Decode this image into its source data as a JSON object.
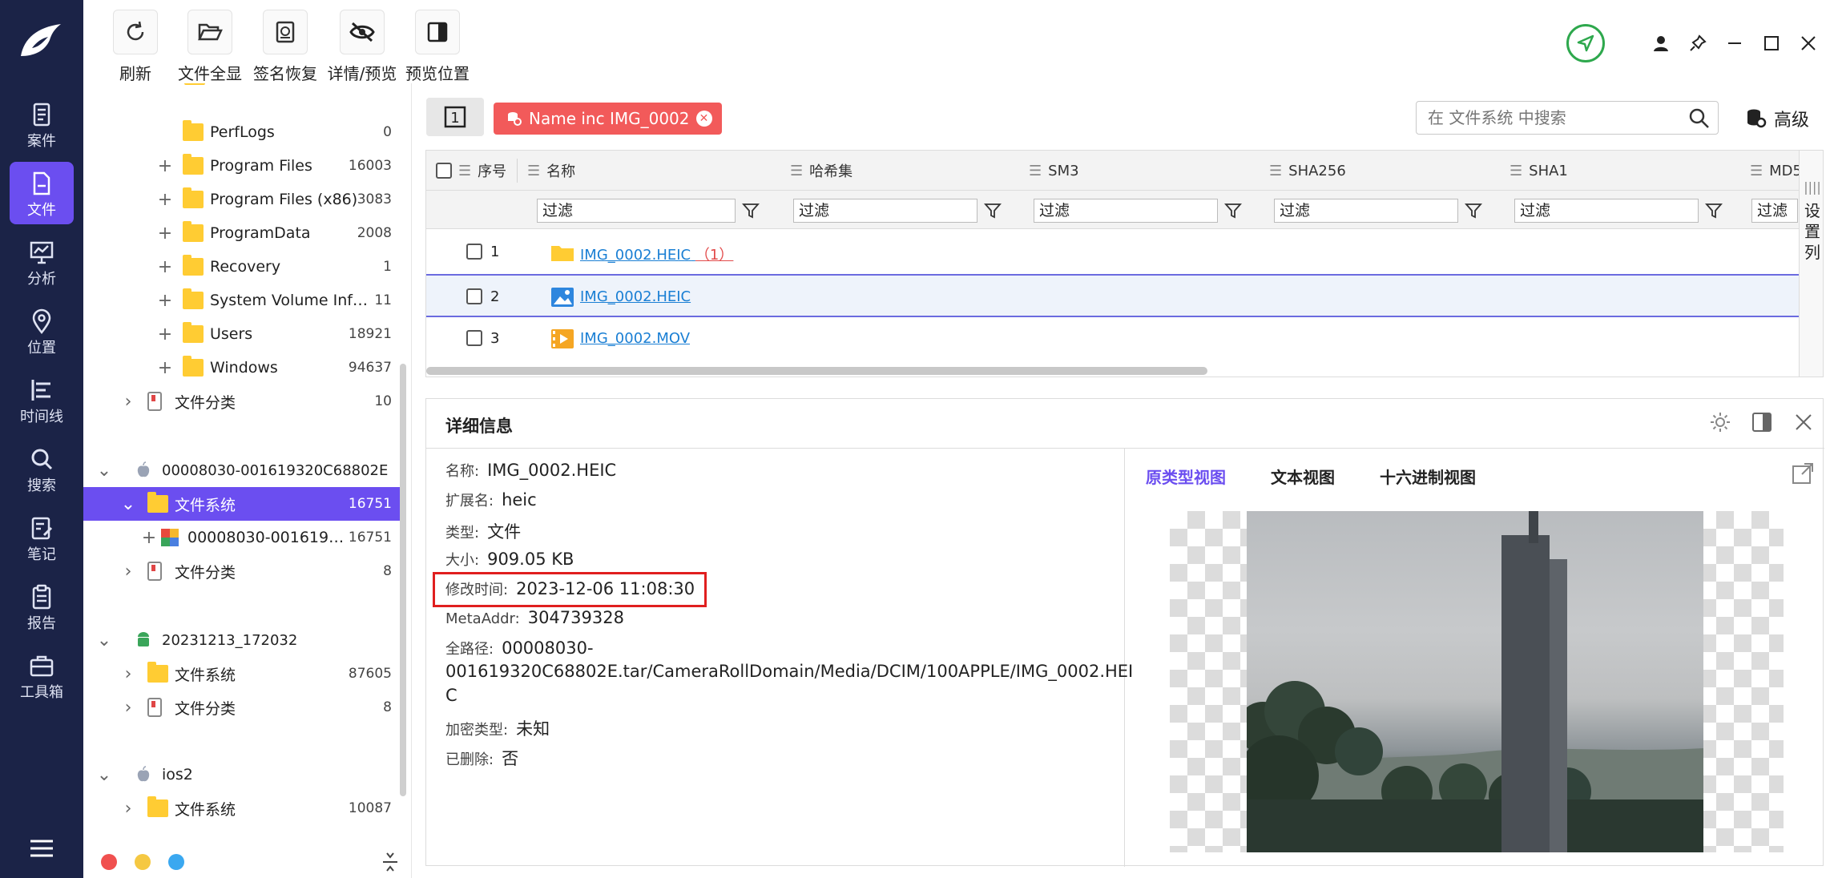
{
  "toolbar": {
    "buttons": [
      {
        "label": "刷新",
        "icon": "refresh-icon"
      },
      {
        "label": "文件全显",
        "icon": "folder-open-icon"
      },
      {
        "label": "签名恢复",
        "icon": "signature-restore-icon"
      },
      {
        "label": "详情/预览",
        "icon": "eye-off-icon"
      },
      {
        "label": "预览位置",
        "icon": "panel-layout-icon"
      }
    ]
  },
  "nav": {
    "items": [
      {
        "label": "案件",
        "icon": "case-icon"
      },
      {
        "label": "文件",
        "icon": "file-icon",
        "active": true
      },
      {
        "label": "分析",
        "icon": "analysis-icon"
      },
      {
        "label": "位置",
        "icon": "location-pin-icon"
      },
      {
        "label": "时间线",
        "icon": "timeline-icon"
      },
      {
        "label": "搜索",
        "icon": "search-icon"
      },
      {
        "label": "笔记",
        "icon": "notes-icon"
      },
      {
        "label": "报告",
        "icon": "report-icon"
      },
      {
        "label": "工具箱",
        "icon": "toolbox-icon"
      }
    ],
    "active_color": "#6b4ef0",
    "background": "#1b2347"
  },
  "tree": {
    "rows": [
      {
        "label": "PerfLogs",
        "count": "0"
      },
      {
        "label": "Program Files",
        "count": "16003"
      },
      {
        "label": "Program Files (x86)",
        "count": "3083"
      },
      {
        "label": "ProgramData",
        "count": "2008"
      },
      {
        "label": "Recovery",
        "count": "1"
      },
      {
        "label": "System Volume Info...",
        "count": "11"
      },
      {
        "label": "Users",
        "count": "18921"
      },
      {
        "label": "Windows",
        "count": "94637"
      },
      {
        "label": "文件分类",
        "count": "10"
      },
      {
        "label": "00008030-001619320C68802E",
        "count": ""
      },
      {
        "label": "文件系统",
        "count": "16751"
      },
      {
        "label": "00008030-00161932...",
        "count": "16751"
      },
      {
        "label": "文件分类",
        "count": "8"
      },
      {
        "label": "20231213_172032",
        "count": ""
      },
      {
        "label": "文件系统",
        "count": "87605"
      },
      {
        "label": "文件分类",
        "count": "8"
      },
      {
        "label": "ios2",
        "count": ""
      },
      {
        "label": "文件系统",
        "count": "10087"
      }
    ]
  },
  "filter_bar": {
    "page_indicator": "1",
    "tag_label": "Name inc IMG_0002",
    "search_placeholder": "在 文件系统 中搜索",
    "advanced_label": "高级"
  },
  "grid": {
    "columns": [
      "序号",
      "名称",
      "哈希集",
      "SM3",
      "SHA256",
      "SHA1",
      "MD5"
    ],
    "filter_placeholder": "过滤",
    "rows": [
      {
        "index": "1",
        "name": "IMG_0002.HEIC",
        "count": "（1）",
        "type": "folder"
      },
      {
        "index": "2",
        "name": "IMG_0002.HEIC",
        "count": "",
        "type": "image"
      },
      {
        "index": "3",
        "name": "IMG_0002.MOV",
        "count": "",
        "type": "video"
      }
    ],
    "column_settings_label": "设置列"
  },
  "details": {
    "title": "详细信息",
    "fields": [
      {
        "key": "名称:",
        "value": "IMG_0002.HEIC"
      },
      {
        "key": "扩展名:",
        "value": "heic"
      },
      {
        "key": "类型:",
        "value": "文件"
      },
      {
        "key": "大小:",
        "value": "909.05 KB"
      },
      {
        "key": "修改时间:",
        "value": "2023-12-06 11:08:30"
      },
      {
        "key": "MetaAddr:",
        "value": "304739328"
      },
      {
        "key": "全路径:",
        "value": "00008030-"
      },
      {
        "key": "加密类型:",
        "value": "未知"
      },
      {
        "key": "已删除:",
        "value": "否"
      }
    ],
    "full_path_line2": "001619320C68802E.tar/CameraRollDomain/Media/DCIM/100APPLE/IMG_0002.HEI",
    "full_path_line3": "C",
    "tabs": [
      "原类型视图",
      "文本视图",
      "十六进制视图"
    ],
    "active_tab_color": "#6b4ef0"
  }
}
